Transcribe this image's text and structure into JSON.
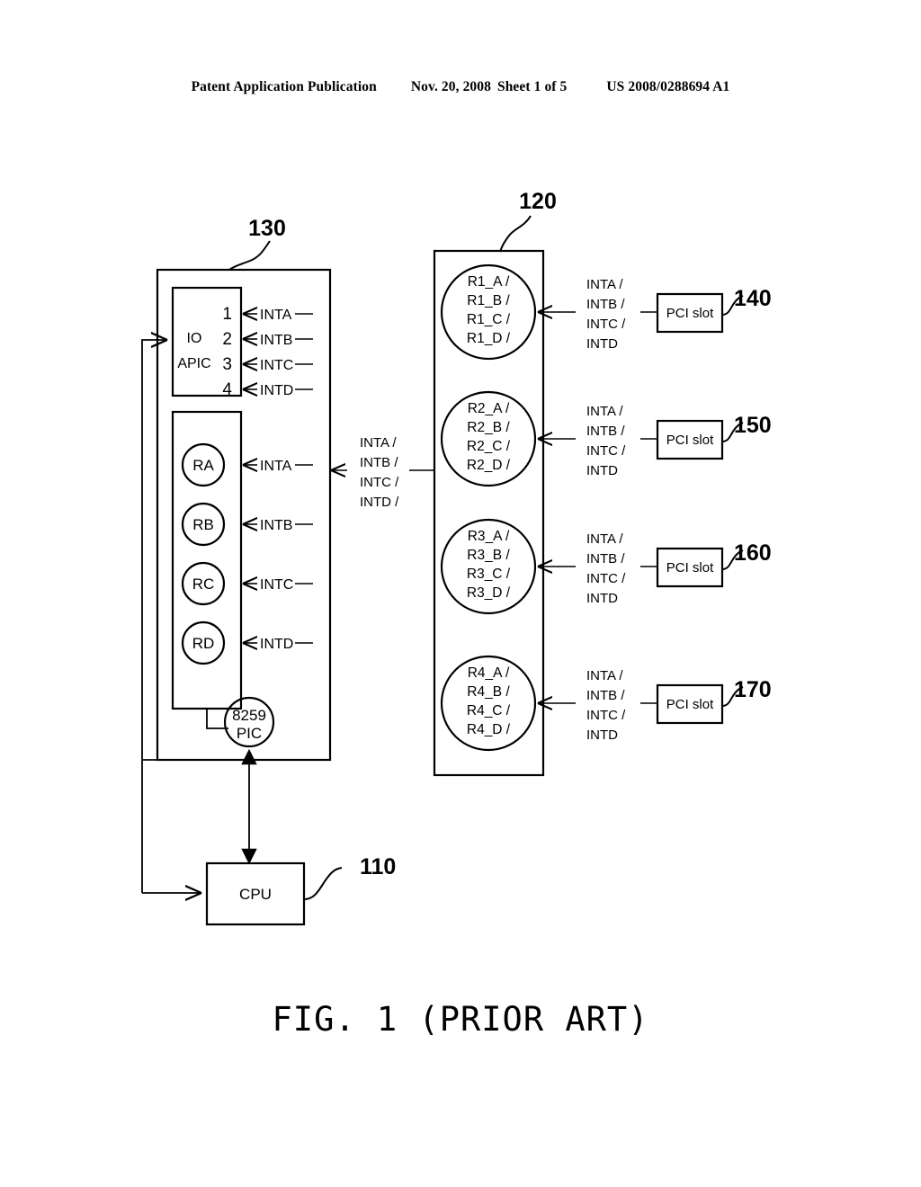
{
  "header": {
    "publication": "Patent Application Publication",
    "date": "Nov. 20, 2008",
    "sheet": "Sheet 1 of 5",
    "patent_number": "US 2008/0288694 A1"
  },
  "caption": "FIG. 1 (PRIOR ART)",
  "reference_numerals": {
    "cpu": "110",
    "router_block": "120",
    "interrupt_controller_block": "130",
    "pci_slot_1": "140",
    "pci_slot_2": "150",
    "pci_slot_3": "160",
    "pci_slot_4": "170"
  },
  "blocks": {
    "cpu": {
      "label": "CPU"
    },
    "io_apic": {
      "name_line1": "IO",
      "name_line2": "APIC",
      "pins": [
        "1",
        "2",
        "3",
        "4"
      ],
      "pin_signals": [
        "INTA",
        "INTB",
        "INTC",
        "INTD"
      ]
    },
    "pic": {
      "line1": "8259",
      "line2": "PIC"
    },
    "registers": [
      {
        "label": "RA",
        "signal": "INTA"
      },
      {
        "label": "RB",
        "signal": "INTB"
      },
      {
        "label": "RC",
        "signal": "INTC"
      },
      {
        "label": "RD",
        "signal": "INTD"
      }
    ],
    "bus_label": [
      "INTA  /",
      "INTB  /",
      "INTC  /",
      "INTD  /"
    ],
    "routers": [
      {
        "lines": [
          "R1_A  /",
          "R1_B  /",
          "R1_C  /",
          "R1_D  /"
        ],
        "slot_signals": [
          "INTA  /",
          "INTB  /",
          "INTC  /",
          "INTD"
        ],
        "slot_label": "PCI slot",
        "slot_ref": "140"
      },
      {
        "lines": [
          "R2_A  /",
          "R2_B  /",
          "R2_C  /",
          "R2_D  /"
        ],
        "slot_signals": [
          "INTA  /",
          "INTB  /",
          "INTC  /",
          "INTD"
        ],
        "slot_label": "PCI slot",
        "slot_ref": "150"
      },
      {
        "lines": [
          "R3_A  /",
          "R3_B  /",
          "R3_C  /",
          "R3_D  /"
        ],
        "slot_signals": [
          "INTA  /",
          "INTB  /",
          "INTC  /",
          "INTD"
        ],
        "slot_label": "PCI slot",
        "slot_ref": "160"
      },
      {
        "lines": [
          "R4_A  /",
          "R4_B  /",
          "R4_C  /",
          "R4_D  /"
        ],
        "slot_signals": [
          "INTA  /",
          "INTB  /",
          "INTC  /",
          "INTD"
        ],
        "slot_label": "PCI slot",
        "slot_ref": "170"
      }
    ]
  },
  "colors": {
    "ink": "#000000",
    "paper": "#ffffff"
  }
}
